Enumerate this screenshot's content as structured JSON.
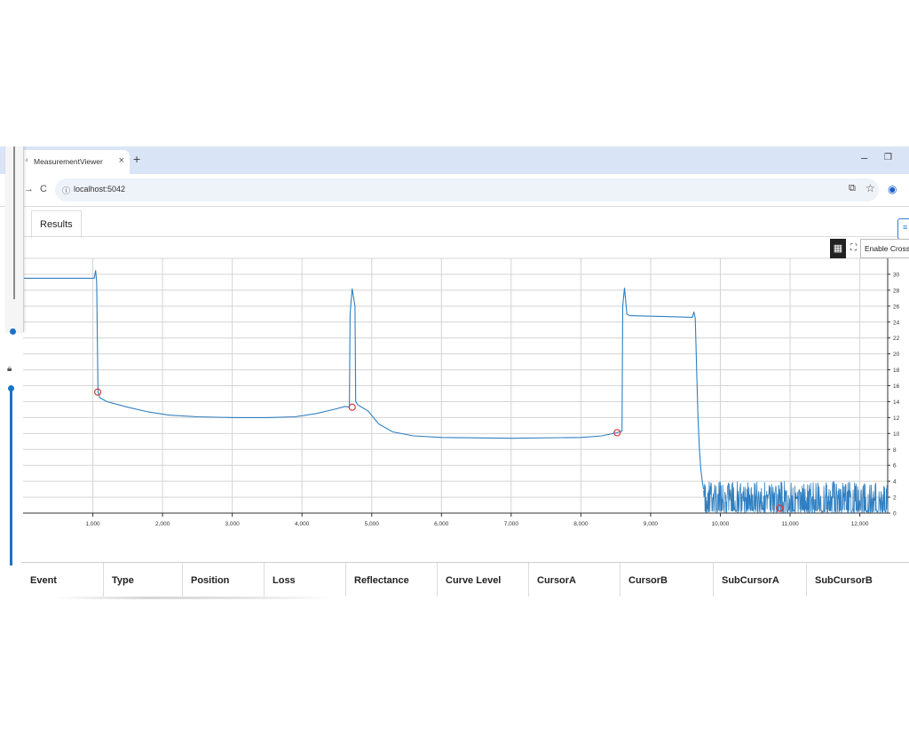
{
  "browser": {
    "tab_title": "MeasurementViewer",
    "tab_close": "×",
    "new_tab": "+",
    "minimize": "–",
    "restore": "❐",
    "url": "localhost:5042"
  },
  "app": {
    "tabs": [
      {
        "label": "Results"
      }
    ],
    "chart_tools": {
      "crosshair_label": "Enable Crossh"
    }
  },
  "chart_data": {
    "type": "line",
    "xlim": [
      0,
      12400
    ],
    "ylim": [
      0,
      32
    ],
    "x_ticks": [
      1000,
      2000,
      3000,
      4000,
      5000,
      6000,
      7000,
      8000,
      9000,
      10000,
      11000,
      12000
    ],
    "x_tick_labels": [
      "1,000",
      "2,000",
      "3,000",
      "4,000",
      "5,000",
      "6,000",
      "7,000",
      "8,000",
      "9,000",
      "10,000",
      "11,000",
      "12,000"
    ],
    "y_ticks": [
      0,
      2,
      4,
      6,
      8,
      10,
      12,
      14,
      16,
      18,
      20,
      22,
      24,
      26,
      28,
      30
    ],
    "grid": true,
    "color": "#2f7fc1",
    "trace_points": [
      [
        0,
        29.5
      ],
      [
        1020,
        29.5
      ],
      [
        1040,
        30.5
      ],
      [
        1055,
        29
      ],
      [
        1075,
        15.2
      ],
      [
        1100,
        14.5
      ],
      [
        1200,
        14.0
      ],
      [
        1500,
        13.3
      ],
      [
        1800,
        12.7
      ],
      [
        2100,
        12.3
      ],
      [
        2500,
        12.1
      ],
      [
        3000,
        12.0
      ],
      [
        3500,
        12.0
      ],
      [
        3900,
        12.1
      ],
      [
        4200,
        12.5
      ],
      [
        4450,
        13.0
      ],
      [
        4620,
        13.4
      ],
      [
        4680,
        13.3
      ],
      [
        4690,
        25
      ],
      [
        4720,
        28.2
      ],
      [
        4760,
        26
      ],
      [
        4770,
        14.0
      ],
      [
        4800,
        13.6
      ],
      [
        4950,
        12.8
      ],
      [
        5100,
        11.2
      ],
      [
        5300,
        10.2
      ],
      [
        5600,
        9.7
      ],
      [
        6000,
        9.5
      ],
      [
        7000,
        9.4
      ],
      [
        8000,
        9.5
      ],
      [
        8300,
        9.7
      ],
      [
        8520,
        10.1
      ],
      [
        8590,
        10.3
      ],
      [
        8600,
        26
      ],
      [
        8625,
        28.3
      ],
      [
        8650,
        26
      ],
      [
        8660,
        25.0
      ],
      [
        8700,
        24.8
      ],
      [
        9600,
        24.6
      ],
      [
        9620,
        25.3
      ],
      [
        9640,
        24.5
      ],
      [
        9660,
        18
      ],
      [
        9680,
        12
      ],
      [
        9700,
        8
      ],
      [
        9720,
        5.5
      ],
      [
        9740,
        4
      ],
      [
        9760,
        3
      ]
    ],
    "noise_range": [
      9760,
      12400
    ],
    "noise_max_dB": 4.0,
    "event_markers": [
      {
        "x": 1070,
        "y": 15.2
      },
      {
        "x": 4720,
        "y": 13.3
      },
      {
        "x": 8520,
        "y": 10.1
      },
      {
        "x": 10850,
        "y": 0.6
      }
    ]
  },
  "table": {
    "columns": [
      "Event",
      "Type",
      "Position",
      "Loss",
      "Reflectance",
      "Curve Level",
      "CursorA",
      "CursorB",
      "SubCursorA",
      "SubCursorB"
    ]
  }
}
